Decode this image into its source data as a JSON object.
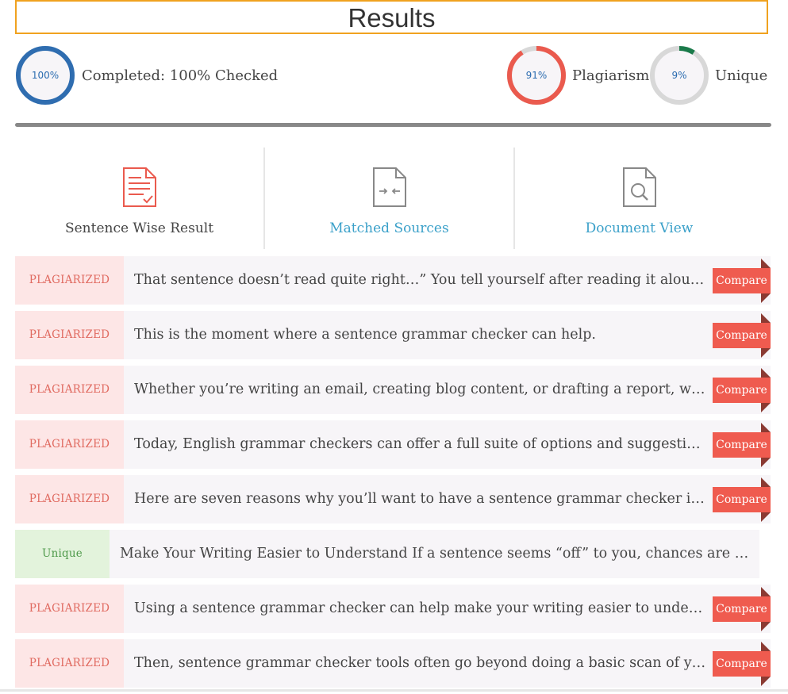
{
  "header": {
    "title": "Results"
  },
  "stats": {
    "completed": {
      "percent_label": "100%",
      "label": "Completed: 100% Checked",
      "fraction": 1.0,
      "color": "#2f6db0"
    },
    "plagiarism": {
      "percent_label": "91%",
      "label": "Plagiarism",
      "fraction": 0.91,
      "color": "#ea5a4e"
    },
    "unique": {
      "percent_label": "9%",
      "label": "Unique",
      "fraction": 0.09,
      "color": "#1a7a4a"
    }
  },
  "tabs": {
    "sentence": "Sentence Wise Result",
    "matched": "Matched Sources",
    "document": "Document View"
  },
  "rows": [
    {
      "status": "PLAGIARIZED",
      "text": "That sentence doesn’t read quite right…” You tell yourself after reading it aloud several times.",
      "action": "Compare"
    },
    {
      "status": "PLAGIARIZED",
      "text": "This is the moment where a sentence grammar checker can help.",
      "action": "Compare"
    },
    {
      "status": "PLAGIARIZED",
      "text": "Whether you’re writing an email, creating blog content, or drafting a report, writing clearly matters.",
      "action": "Compare"
    },
    {
      "status": "PLAGIARIZED",
      "text": "Today, English grammar checkers can offer a full suite of options and suggestions to improve your text.",
      "action": "Compare"
    },
    {
      "status": "PLAGIARIZED",
      "text": "Here are seven reasons why you’ll want to have a sentence grammar checker in your toolbox.",
      "action": "Compare"
    },
    {
      "status": "Unique",
      "text": "Make Your Writing Easier to Understand If a sentence seems “off” to you, chances are your readers will notice too.",
      "action": ""
    },
    {
      "status": "PLAGIARIZED",
      "text": "Using a sentence grammar checker can help make your writing easier to understand by correcting errors.",
      "action": "Compare"
    },
    {
      "status": "PLAGIARIZED",
      "text": "Then, sentence grammar checker tools often go beyond doing a basic scan of your writing.",
      "action": "Compare"
    }
  ]
}
